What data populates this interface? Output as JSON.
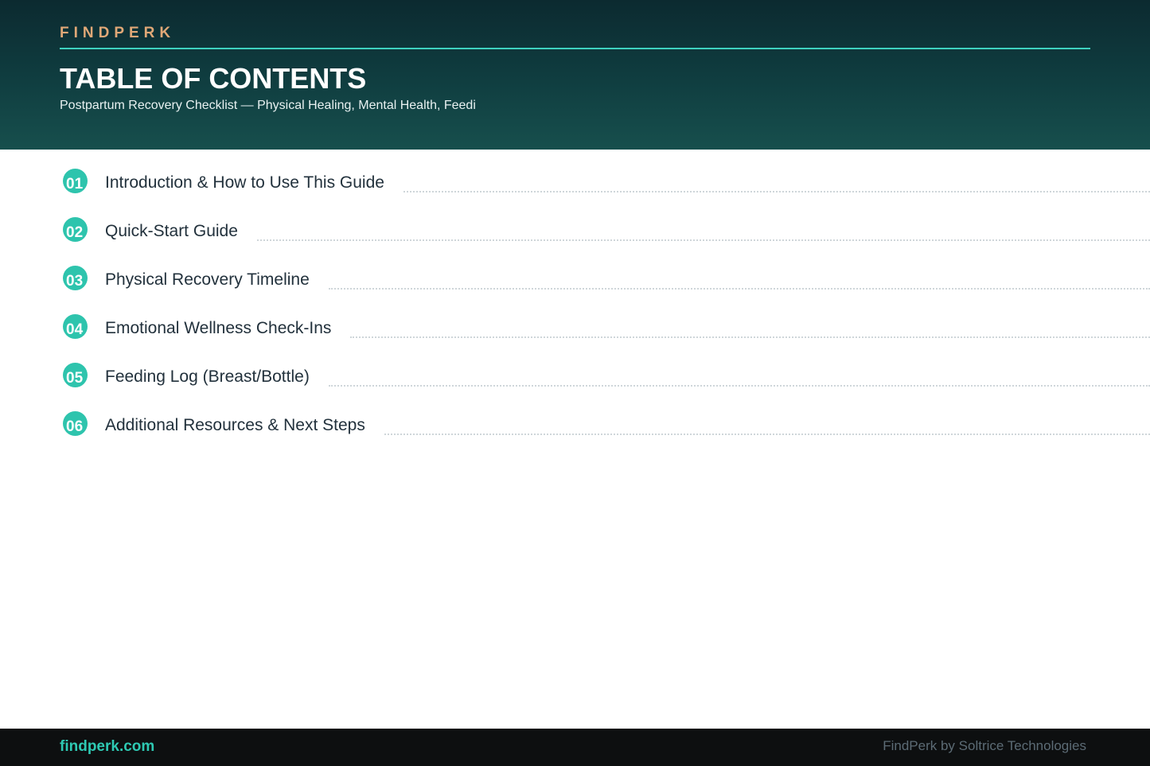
{
  "header": {
    "brand": "FINDPERK",
    "title": "TABLE OF CONTENTS",
    "subtitle": "Postpartum Recovery Checklist — Physical Healing, Mental Health, Feedi"
  },
  "toc": {
    "items": [
      {
        "number": "01",
        "label": "Introduction & How to Use This Guide"
      },
      {
        "number": "02",
        "label": "Quick-Start Guide"
      },
      {
        "number": "03",
        "label": "Physical Recovery Timeline"
      },
      {
        "number": "04",
        "label": "Emotional Wellness Check-Ins"
      },
      {
        "number": "05",
        "label": "Feeding Log (Breast/Bottle)"
      },
      {
        "number": "06",
        "label": "Additional Resources & Next Steps"
      }
    ]
  },
  "footer": {
    "url": "findperk.com",
    "credit": "FindPerk by Soltrice Technologies"
  },
  "colors": {
    "accent_teal": "#2ec4ad",
    "brand_gold": "#e0a877",
    "header_dark": "#0c2a30",
    "footer_dark": "#0d0f10"
  }
}
